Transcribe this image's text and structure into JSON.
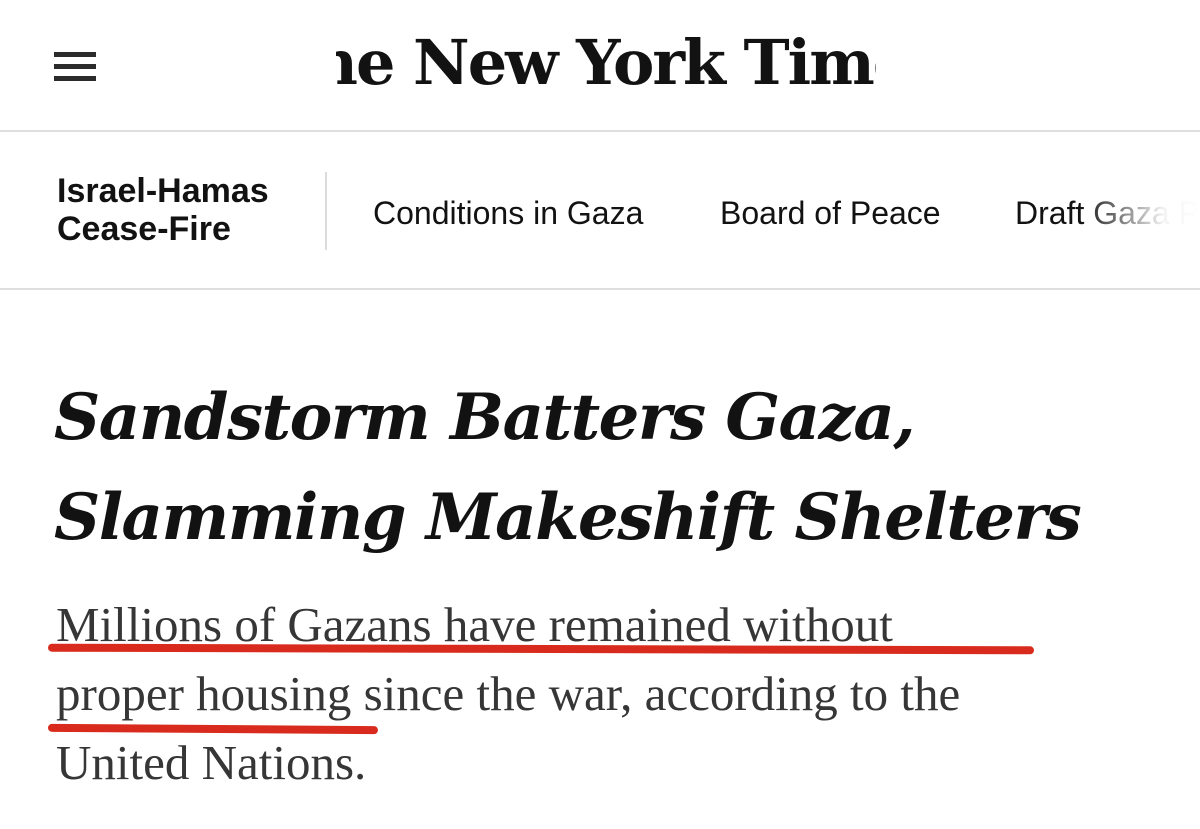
{
  "masthead": {
    "menu_icon": "hamburger-menu-icon",
    "logo_text": "The New York Times"
  },
  "section_nav": {
    "section_title_line1": "Israel-Hamas",
    "section_title_line2": "Cease-Fire",
    "links": [
      {
        "label": "Conditions in Gaza"
      },
      {
        "label": "Board of Peace"
      },
      {
        "label": "Draft Gaza P"
      }
    ]
  },
  "article": {
    "headline_line1": "Sandstorm Batters Gaza,",
    "headline_line2": "Slamming Makeshift Shelters",
    "summary_line1": "Millions of Gazans have remained without",
    "summary_line2": "proper housing since the war, according to the",
    "summary_line3": "United Nations."
  },
  "colors": {
    "underline_annotation": "#d92b1d",
    "text": "#121212",
    "summary_text": "#363636",
    "divider": "#dfdfdf"
  }
}
